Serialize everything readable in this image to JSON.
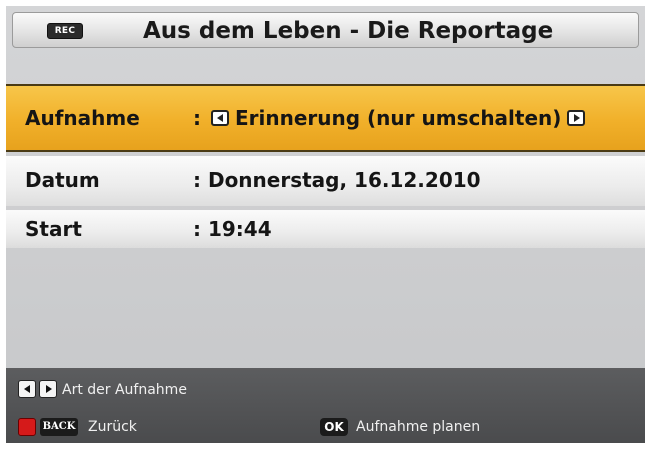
{
  "header": {
    "rec_icon_label": "REC",
    "title": "Aus dem Leben - Die Reportage"
  },
  "rows": {
    "aufnahme": {
      "label": "Aufnahme",
      "colon": ":",
      "value": "Erinnerung (nur umschalten)"
    },
    "datum": {
      "label": "Datum",
      "value": ": Donnerstag, 16.12.2010"
    },
    "start": {
      "label": "Start",
      "value": ": 19:44"
    }
  },
  "footer": {
    "hint_type": "Art der Aufnahme",
    "back_key_label": "BACK",
    "hint_back": "Zurück",
    "ok_key_label": "OK",
    "hint_ok": "Aufnahme planen"
  },
  "colors": {
    "highlight": "#f1b02a",
    "footer_bg": "#4a4b4d",
    "record_red": "#d51a1a"
  },
  "icons": {
    "record": "record-icon",
    "left": "arrow-left-icon",
    "right": "arrow-right-icon"
  }
}
